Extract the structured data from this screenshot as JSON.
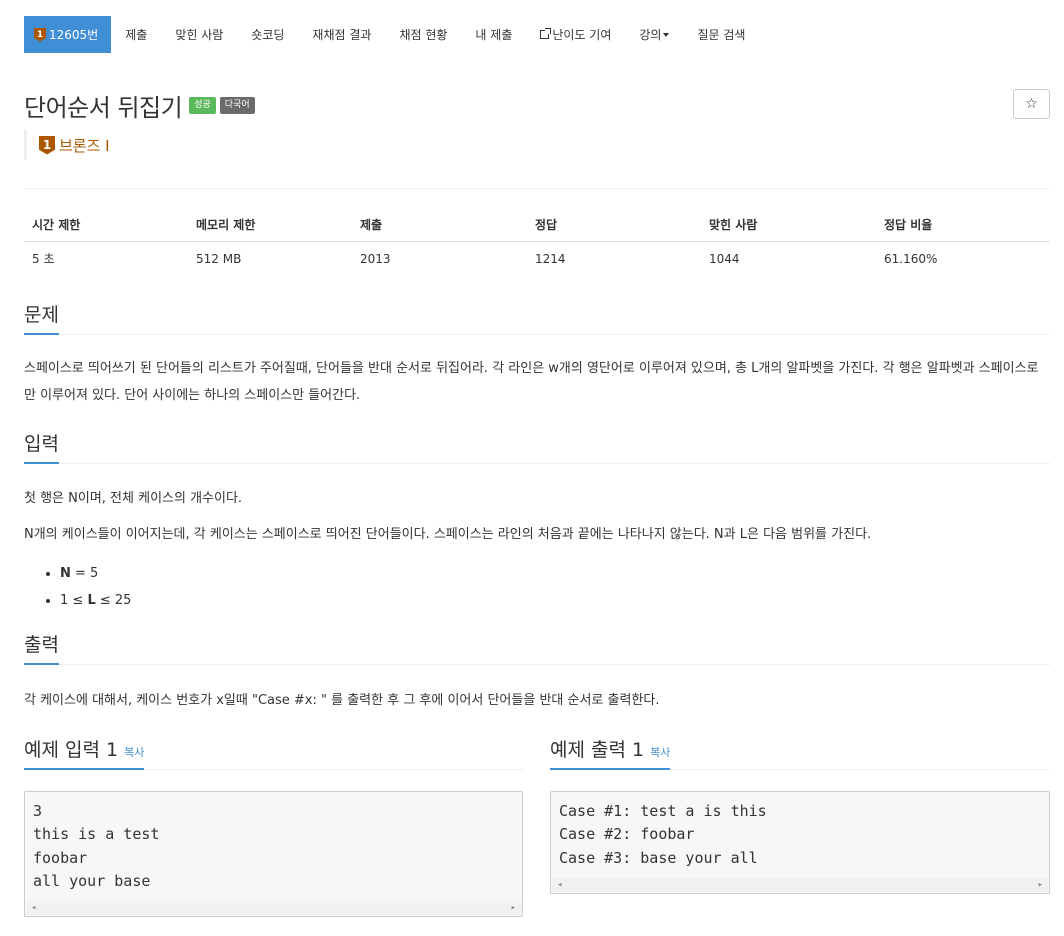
{
  "nav": {
    "problem_tab": "12605번",
    "tier_number": "1",
    "items": [
      "제출",
      "맞힌 사람",
      "숏코딩",
      "재채점 결과",
      "채점 현황",
      "내 제출",
      "난이도 기여",
      "강의",
      "질문 검색"
    ]
  },
  "problem": {
    "title": "단어순서 뒤집기",
    "label_success": "성공",
    "label_multilang": "다국어",
    "star": "☆",
    "tier_number": "1",
    "tier_text": "브론즈 I"
  },
  "table": {
    "headers": [
      "시간 제한",
      "메모리 제한",
      "제출",
      "정답",
      "맞힌 사람",
      "정답 비율"
    ],
    "values": [
      "5 초",
      "512 MB",
      "2013",
      "1214",
      "1044",
      "61.160%"
    ]
  },
  "sections": {
    "problem_heading": "문제",
    "problem_text": "스페이스로 띄어쓰기 된 단어들의 리스트가 주어질때, 단어들을 반대 순서로 뒤집어라. 각 라인은 w개의 영단어로 이루어져 있으며, 총 L개의 알파벳을 가진다. 각 행은 알파벳과 스페이스로만 이루어져 있다. 단어 사이에는 하나의 스페이스만 들어간다.",
    "input_heading": "입력",
    "input_text_1": "첫 행은 N이며, 전체 케이스의 개수이다.",
    "input_text_2": "N개의 케이스들이 이어지는데, 각 케이스는 스페이스로 띄어진 단어들이다. 스페이스는 라인의 처음과 끝에는 나타나지 않는다. N과 L은 다음 범위를 가진다.",
    "limit_1_var": "N",
    "limit_1_rest": " = 5",
    "limit_2_pre": "1 ≤ ",
    "limit_2_var": "L",
    "limit_2_post": " ≤ 25",
    "output_heading": "출력",
    "output_text": "각 케이스에 대해서, 케이스 번호가 x일때  \"Case #x: \" 를 출력한 후 그 후에 이어서 단어들을 반대 순서로 출력한다."
  },
  "samples": {
    "input_heading": "예제 입력 1",
    "output_heading": "예제 출력 1",
    "copy_label": "복사",
    "input_lines": [
      "3",
      "this is a test",
      "foobar",
      "all your base"
    ],
    "output_lines": [
      "Case #1: test a is this",
      "Case #2: foobar",
      "Case #3: base your all"
    ]
  }
}
